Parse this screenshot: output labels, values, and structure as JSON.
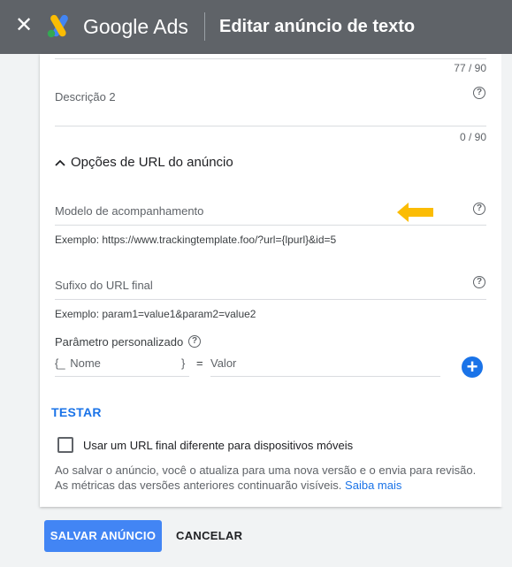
{
  "header": {
    "brand": "Google Ads",
    "title": "Editar anúncio de texto",
    "close_glyph": "✕",
    "logo_icon": "google-ads-logo",
    "colors": {
      "bar": "#5f6368"
    }
  },
  "form": {
    "counter_top": "77 / 90",
    "description2": {
      "label": "Descrição 2",
      "counter": "0 / 90"
    },
    "url_options": {
      "title": "Opções de URL do anúncio",
      "expanded": true,
      "tracking_template": {
        "label": "Modelo de acompanhamento",
        "example": "Exemplo: https://www.trackingtemplate.foo/?url={lpurl}&id=5"
      },
      "final_url_suffix": {
        "label": "Sufixo do URL final",
        "example": "Exemplo: param1=value1&param2=value2"
      },
      "custom_param": {
        "label": "Parâmetro personalizado",
        "name_prefix": "{_",
        "name_placeholder": "Nome",
        "name_suffix": "}",
        "equals": "=",
        "value_placeholder": "Valor"
      }
    },
    "test_label": "TESTAR",
    "mobile_checkbox": {
      "label": "Usar um URL final diferente para dispositivos móveis",
      "checked": false
    },
    "notice": "Ao salvar o anúncio, você o atualiza para uma nova versão e o envia para revisão. As métricas das versões anteriores continuarão visíveis.",
    "learn_more": "Saiba mais"
  },
  "actions": {
    "save": "SALVAR ANÚNCIO",
    "cancel": "CANCELAR"
  },
  "colors": {
    "accent": "#1a73e8",
    "primary_button": "#4285f4",
    "annotation_arrow": "#fbbc04"
  }
}
